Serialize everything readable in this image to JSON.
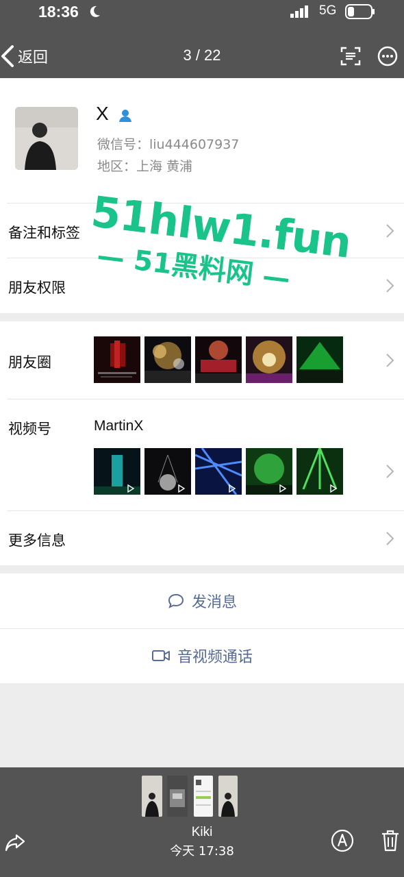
{
  "status_bar": {
    "time": "18:36",
    "network": "5G"
  },
  "nav": {
    "back_label": "返回",
    "counter": "3 / 22"
  },
  "profile": {
    "name": "X",
    "wechat_id": "微信号：liu444607937",
    "region": "地区：上海 黄浦"
  },
  "rows": {
    "remark_tags": "备注和标签",
    "friend_permissions": "朋友权限",
    "moments": "朋友圈",
    "channels": "视频号",
    "channel_name": "MartinX",
    "more_info": "更多信息"
  },
  "actions": {
    "message": "发消息",
    "call": "音视频通话"
  },
  "footer": {
    "sender": "Kiki",
    "time": "今天 17:38"
  },
  "watermark": {
    "line1": "51hlw1.fun",
    "line2": "— 51黑料网 —"
  },
  "colors": {
    "link": "#576b95",
    "watermark": "#19c38a",
    "bar": "#545454",
    "background": "#ededed"
  },
  "icons": [
    "moon-icon",
    "signal-icon",
    "battery-icon",
    "back-icon",
    "scan-icon",
    "more-icon",
    "verified-icon",
    "chevron-right-icon",
    "chat-bubble-icon",
    "video-camera-icon",
    "share-icon",
    "edit-icon",
    "trash-icon"
  ]
}
